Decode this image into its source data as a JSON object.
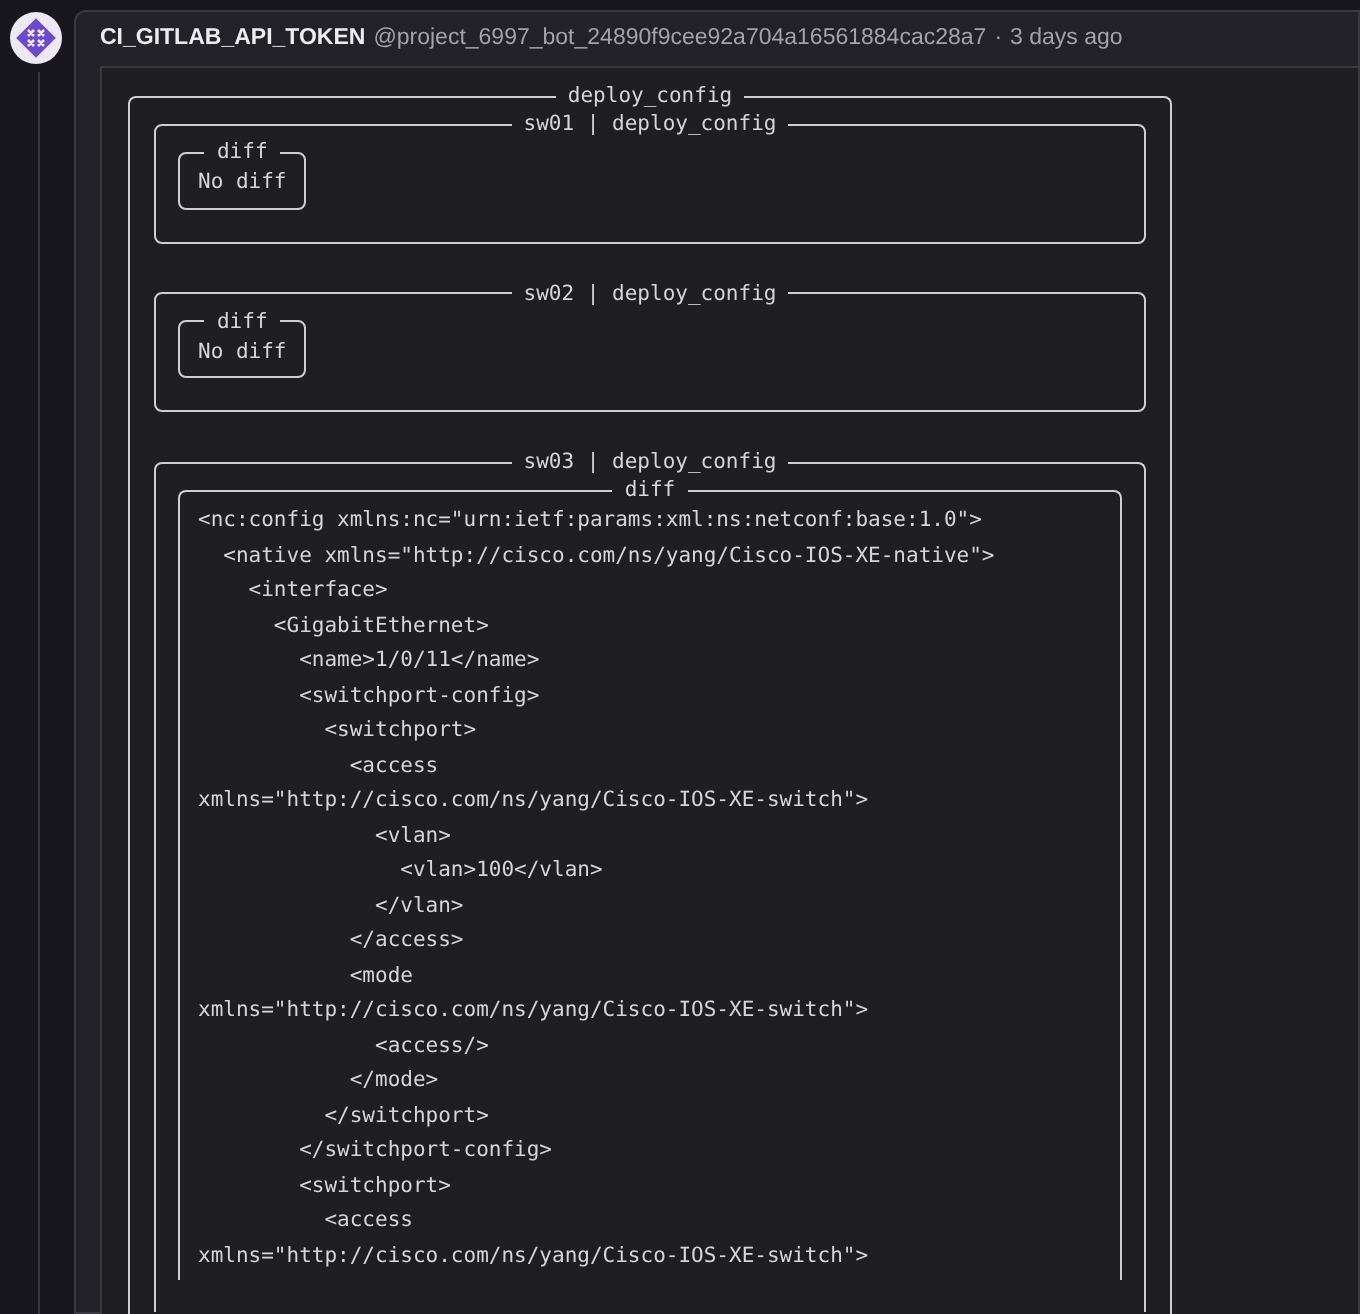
{
  "comment": {
    "author": "CI_GITLAB_API_TOKEN",
    "handle": "@project_6997_bot_24890f9cee92a704a16561884cac28a7",
    "separator": "·",
    "time": "3 days ago"
  },
  "output": {
    "title": "deploy_config",
    "sections": [
      {
        "title": "sw01 | deploy_config",
        "diff": {
          "title": "diff",
          "lines": [
            "No diff"
          ]
        }
      },
      {
        "title": "sw02 | deploy_config",
        "diff": {
          "title": "diff",
          "lines": [
            "No diff"
          ]
        }
      },
      {
        "title": "sw03 | deploy_config",
        "diff": {
          "title": "diff",
          "lines": [
            "<nc:config xmlns:nc=\"urn:ietf:params:xml:ns:netconf:base:1.0\">",
            "  <native xmlns=\"http://cisco.com/ns/yang/Cisco-IOS-XE-native\">",
            "    <interface>",
            "      <GigabitEthernet>",
            "        <name>1/0/11</name>",
            "        <switchport-config>",
            "          <switchport>",
            "            <access",
            "xmlns=\"http://cisco.com/ns/yang/Cisco-IOS-XE-switch\">",
            "              <vlan>",
            "                <vlan>100</vlan>",
            "              </vlan>",
            "            </access>",
            "            <mode",
            "xmlns=\"http://cisco.com/ns/yang/Cisco-IOS-XE-switch\">",
            "              <access/>",
            "            </mode>",
            "          </switchport>",
            "        </switchport-config>",
            "        <switchport>",
            "          <access",
            "xmlns=\"http://cisco.com/ns/yang/Cisco-IOS-XE-switch\">"
          ]
        }
      }
    ]
  }
}
